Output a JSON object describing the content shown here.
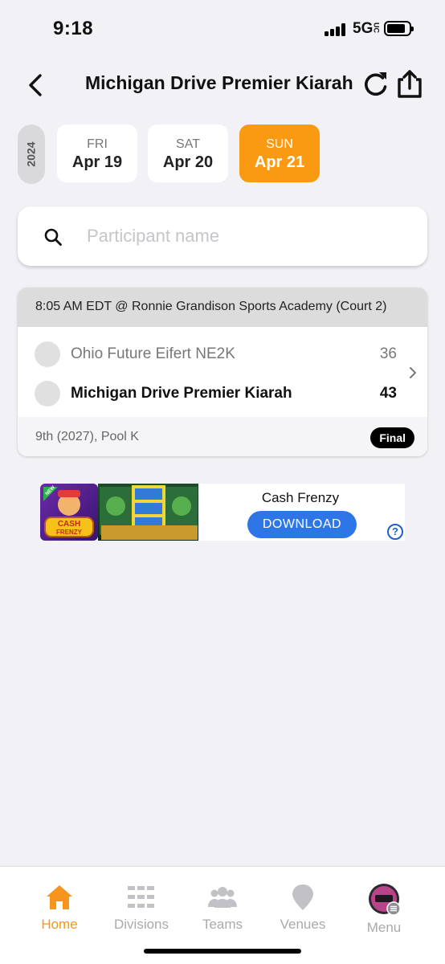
{
  "status_bar": {
    "time": "9:18",
    "network": "5G",
    "network_sub": "UC"
  },
  "header": {
    "title": "Michigan Drive Premier Kiarah"
  },
  "dates": {
    "year": "2024",
    "days": [
      {
        "dow": "FRI",
        "date": "Apr 19",
        "active": false
      },
      {
        "dow": "SAT",
        "date": "Apr 20",
        "active": false
      },
      {
        "dow": "SUN",
        "date": "Apr 21",
        "active": true
      }
    ]
  },
  "search": {
    "placeholder": "Participant name",
    "value": ""
  },
  "game": {
    "header": "8:05 AM EDT @ Ronnie Grandison Sports Academy (Court 2)",
    "teams": [
      {
        "name": "Ohio Future Eifert NE2K",
        "score": "36"
      },
      {
        "name": "Michigan Drive Premier Kiarah",
        "score": "43"
      }
    ],
    "pool": "9th (2027), Pool K",
    "status": "Final"
  },
  "ad": {
    "title": "Cash Frenzy",
    "button": "DOWNLOAD",
    "info": "?",
    "image_text": {
      "badge": "NEW",
      "logo_top": "CASH",
      "logo_bottom": "FRENZY"
    }
  },
  "nav": [
    {
      "label": "Home",
      "icon": "home-icon",
      "active": true
    },
    {
      "label": "Divisions",
      "icon": "divisions-icon",
      "active": false
    },
    {
      "label": "Teams",
      "icon": "teams-icon",
      "active": false
    },
    {
      "label": "Venues",
      "icon": "venues-icon",
      "active": false
    },
    {
      "label": "Menu",
      "icon": "menu-avatar-icon",
      "active": false
    }
  ],
  "colors": {
    "accent": "#fa9a13",
    "nav_active": "#f7941d",
    "background": "#f2f2f6",
    "ad_button": "#2e75e6",
    "final_badge": "#000000"
  }
}
